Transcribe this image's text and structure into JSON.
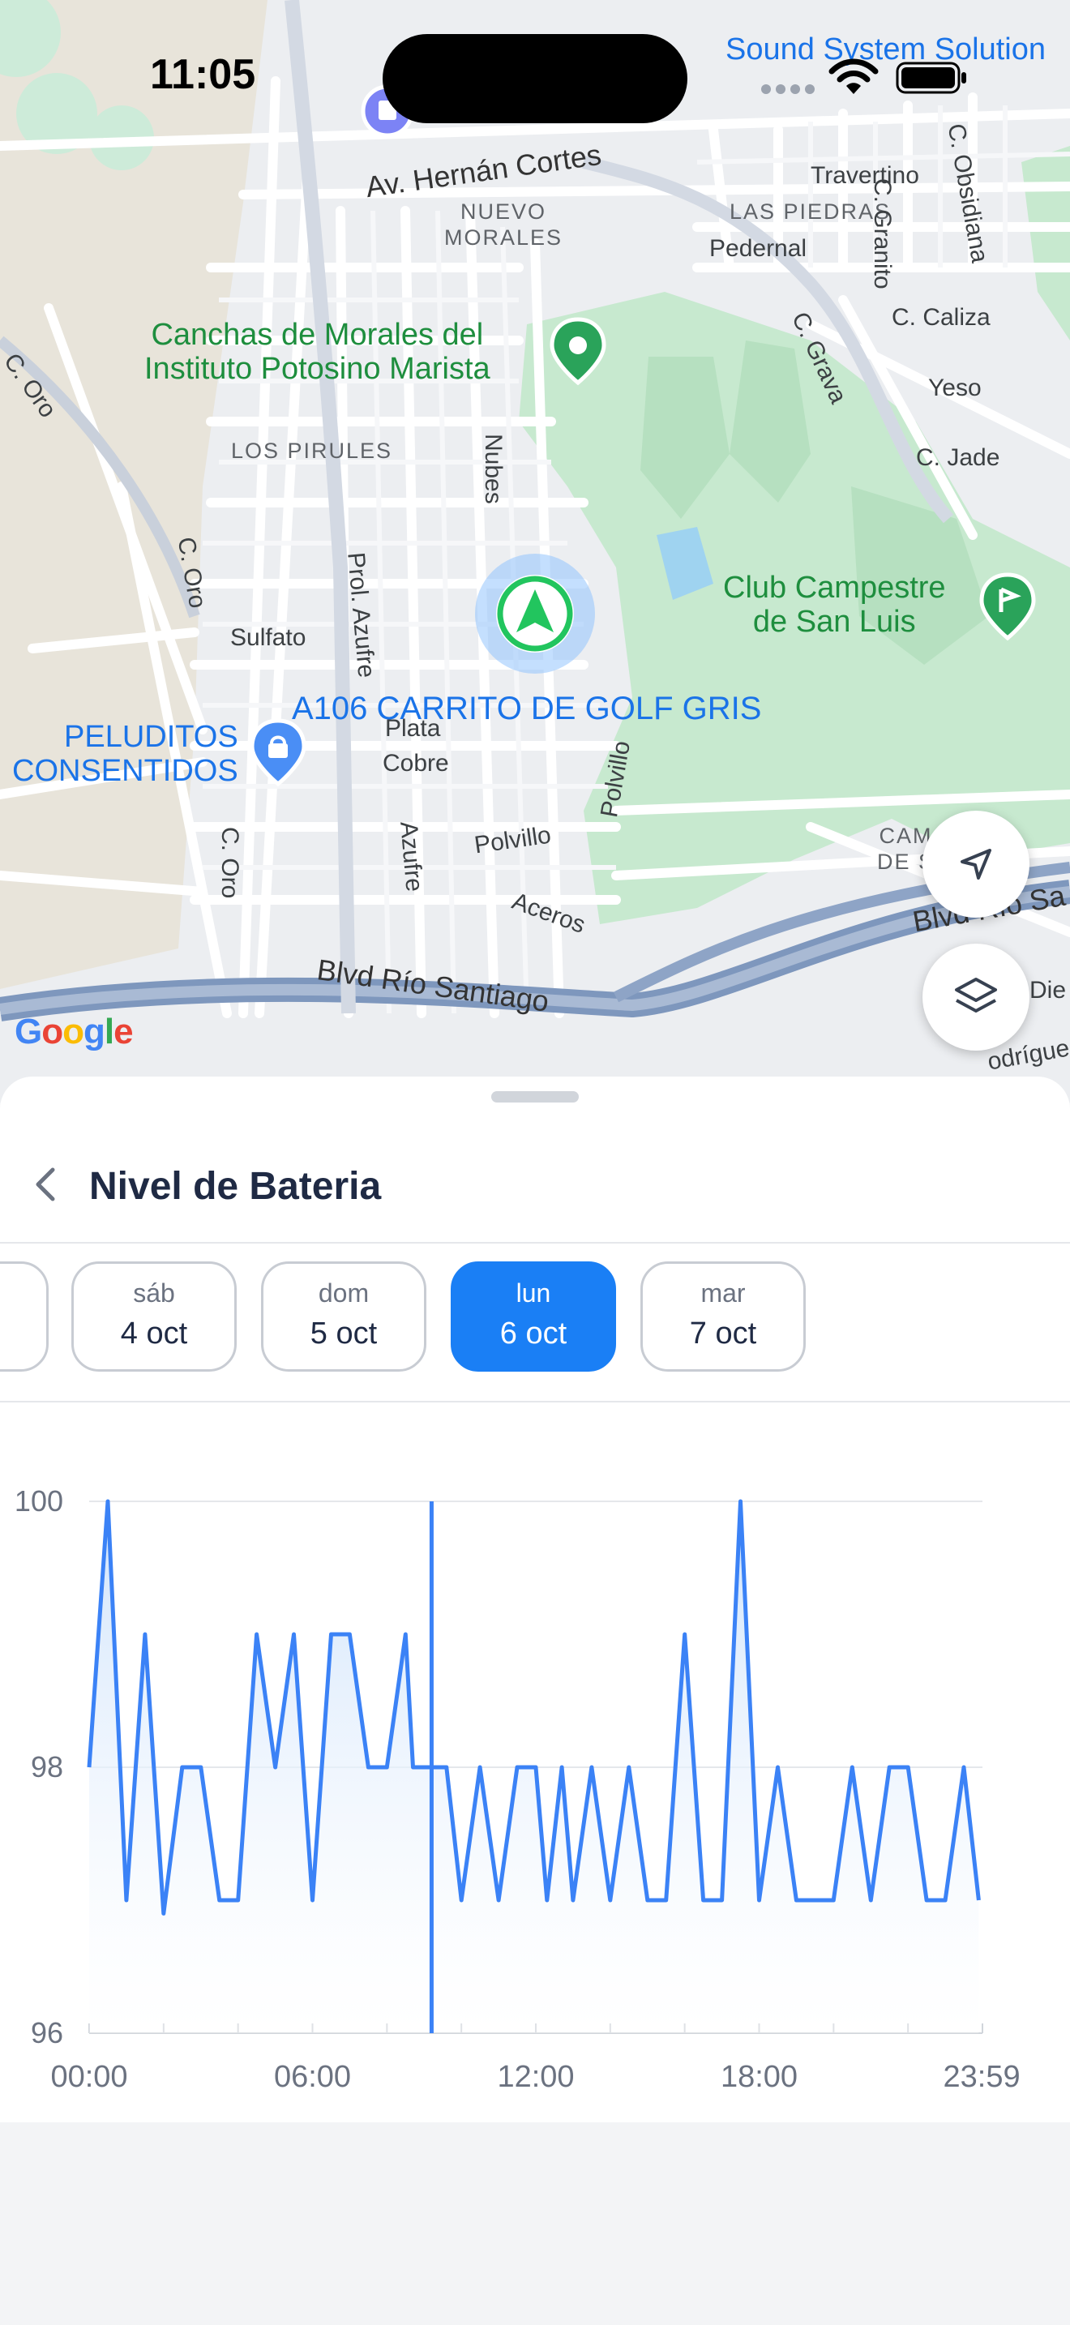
{
  "status_bar": {
    "time": "11:05"
  },
  "map": {
    "labels": {
      "sound_system": "Sound System Solution",
      "av_hernan": "Av. Hernán Cortes",
      "nuevo_morales": [
        "NUEVO",
        "MORALES"
      ],
      "las_piedras": "LAS PIEDRAS",
      "travertino": "Travertino",
      "pedernal": "Pedernal",
      "c_granito": "C. Granito",
      "c_obsidiana": "C. Obsidiana",
      "canchas": [
        "Canchas de Morales del",
        "Instituto Potosino Marista"
      ],
      "c_oro_top": "C. Oro",
      "c_grava": "C. Grava",
      "c_caliza": "C. Caliza",
      "yeso": "Yeso",
      "c_jade": "C. Jade",
      "los_pirules": "LOS PIRULES",
      "nubes": "Nubes",
      "c_oro_mid": "C. Oro",
      "prol_azufre": "Prol. Azufre",
      "sulfato": "Sulfato",
      "club_campestre": [
        "Club Campestre",
        "de San Luis"
      ],
      "peluditos": [
        "PELUDITOS",
        "CONSENTIDOS"
      ],
      "plata": "Plata",
      "cobre": "Cobre",
      "c_oro_low": "C. Oro",
      "azufre": "Azufre",
      "polvillo_a": "Polvillo",
      "polvillo_b": "Polvillo",
      "aceros": "Aceros",
      "camp": [
        "CAM",
        "DE S"
      ],
      "blvd_rio_santiago": "Blvd Río Santiago",
      "blvd_rio_sa": "Blvd Río Sa",
      "die": "Die",
      "rodrigue": "odrígue",
      "google": "Google"
    },
    "vehicle_label": "A106 CARRITO DE GOLF GRIS"
  },
  "sheet": {
    "title": "Nivel de Bateria",
    "days": [
      {
        "dow": "sáb",
        "date": "4 oct",
        "active": false
      },
      {
        "dow": "dom",
        "date": "5 oct",
        "active": false
      },
      {
        "dow": "lun",
        "date": "6 oct",
        "active": true
      },
      {
        "dow": "mar",
        "date": "7 oct",
        "active": false
      }
    ]
  },
  "colors": {
    "accent": "#1a7ff5",
    "line": "#3b82f6",
    "fill_top": "#cfe3fb"
  },
  "icons": {
    "vehicle": "navigation-arrow-icon",
    "locate": "location-arrow-icon",
    "layers": "layers-icon",
    "back": "chevron-left-icon"
  },
  "chart_data": {
    "type": "area",
    "title": "",
    "ylim": [
      96,
      100
    ],
    "yticks": [
      96,
      98,
      100
    ],
    "xlim": [
      0,
      24
    ],
    "xticks": [
      {
        "label": "00:00",
        "x": 0
      },
      {
        "label": "06:00",
        "x": 6
      },
      {
        "label": "12:00",
        "x": 12
      },
      {
        "label": "18:00",
        "x": 18
      },
      {
        "label": "23:59",
        "x": 23.98
      }
    ],
    "grid": true,
    "cursor_x": 9.2,
    "series": [
      {
        "x": [
          0.0,
          0.5,
          1.0,
          1.5,
          2.0,
          2.5,
          3.0,
          3.5,
          4.0,
          4.5,
          5.0,
          5.5,
          6.0,
          6.5,
          7.0,
          7.5,
          8.0,
          8.5,
          8.7,
          9.0,
          9.3,
          9.6,
          10.0,
          10.5,
          11.0,
          11.5,
          12.0,
          12.3,
          12.7,
          13.0,
          13.5,
          14.0,
          14.5,
          15.0,
          15.5,
          16.0,
          16.5,
          17.0,
          17.5,
          18.0,
          18.5,
          19.0,
          19.5,
          20.0,
          20.5,
          21.0,
          21.5,
          22.0,
          22.5,
          23.0,
          23.5,
          23.9
        ],
        "y": [
          98,
          100,
          97,
          99,
          96.9,
          98,
          98,
          97,
          97,
          99,
          98,
          99,
          97,
          99,
          99,
          98,
          98,
          99,
          98,
          98,
          98,
          98,
          97,
          98,
          97,
          98,
          98,
          97,
          98,
          97,
          98,
          97,
          98,
          97,
          97,
          99,
          97,
          97,
          100,
          97,
          98,
          97,
          97,
          97,
          98,
          97,
          98,
          98,
          97,
          97,
          98,
          97
        ]
      }
    ]
  }
}
